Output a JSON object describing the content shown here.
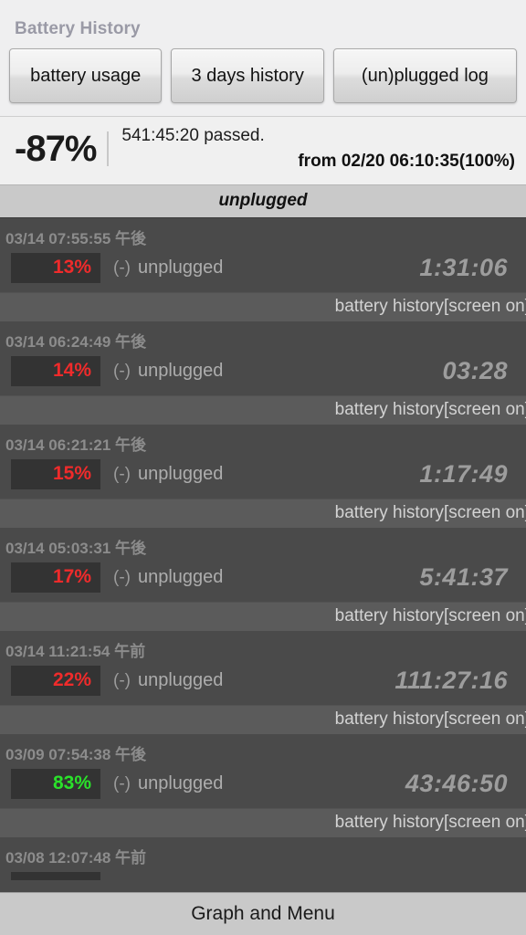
{
  "app": {
    "title": "Battery History"
  },
  "toolbar": {
    "buttons": [
      {
        "label": "battery usage",
        "name": "battery-usage-button"
      },
      {
        "label": "3 days history",
        "name": "three-days-history-button"
      },
      {
        "label": "(un)plugged log",
        "name": "unplugged-log-button"
      }
    ]
  },
  "summary": {
    "percent": "-87%",
    "elapsed": "541:45:20  passed.",
    "from": "from 02/20 06:10:35(100%)"
  },
  "section": {
    "header": "unplugged"
  },
  "colors": {
    "accent_red": "#ef2b2b",
    "accent_green": "#2ae22a",
    "list_bg": "#4a4a4a",
    "sub_bg": "#5b5b5b",
    "panel_bg": "#efeff0",
    "section_bg": "#c9c9c9",
    "title_color": "#9a9aa6"
  },
  "entries": [
    {
      "timestamp": "03/14 07:55:55 午後",
      "percent": "13%",
      "percent_color": "red",
      "sign": "(-)",
      "state": "unplugged",
      "duration": "1:31:06",
      "source": "battery history[screen on]"
    },
    {
      "timestamp": "03/14 06:24:49 午後",
      "percent": "14%",
      "percent_color": "red",
      "sign": "(-)",
      "state": "unplugged",
      "duration": "03:28",
      "source": "battery history[screen on]"
    },
    {
      "timestamp": "03/14 06:21:21 午後",
      "percent": "15%",
      "percent_color": "red",
      "sign": "(-)",
      "state": "unplugged",
      "duration": "1:17:49",
      "source": "battery history[screen on]"
    },
    {
      "timestamp": "03/14 05:03:31 午後",
      "percent": "17%",
      "percent_color": "red",
      "sign": "(-)",
      "state": "unplugged",
      "duration": "5:41:37",
      "source": "battery history[screen on]"
    },
    {
      "timestamp": "03/14 11:21:54 午前",
      "percent": "22%",
      "percent_color": "red",
      "sign": "(-)",
      "state": "unplugged",
      "duration": "111:27:16",
      "source": "battery history[screen on]"
    },
    {
      "timestamp": "03/09 07:54:38 午後",
      "percent": "83%",
      "percent_color": "green",
      "sign": "(-)",
      "state": "unplugged",
      "duration": "43:46:50",
      "source": "battery history[screen on]"
    },
    {
      "timestamp": "03/08 12:07:48 午前",
      "percent": "",
      "percent_color": "red",
      "sign": "",
      "state": "",
      "duration": "",
      "source": ""
    }
  ],
  "bottom_bar": {
    "label": "Graph and Menu"
  }
}
